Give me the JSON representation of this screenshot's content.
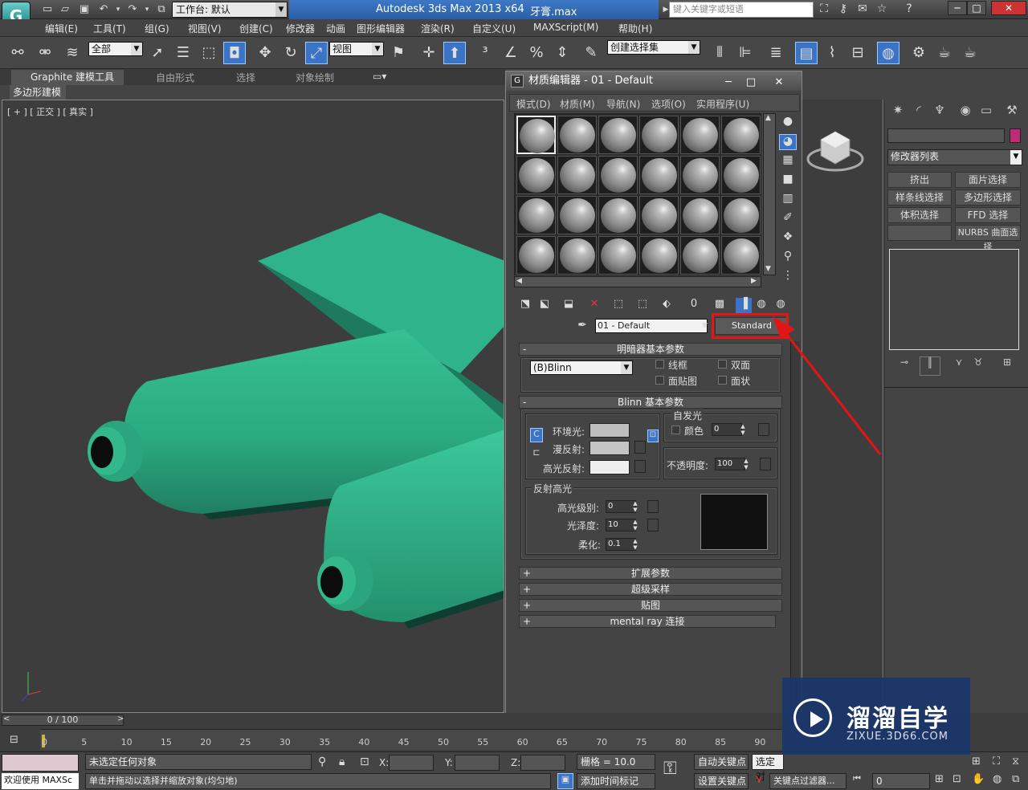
{
  "title": {
    "app_name": "Autodesk 3ds Max  2013 x64",
    "file_name": "牙膏.max",
    "workspace": "工作台: 默认",
    "search_placeholder": "键入关键字或短语"
  },
  "menus": [
    "编辑(E)",
    "工具(T)",
    "组(G)",
    "视图(V)",
    "创建(C)",
    "修改器",
    "动画",
    "图形编辑器",
    "渲染(R)",
    "自定义(U)",
    "MAXScript(M)",
    "帮助(H)"
  ],
  "toolbar": {
    "filter": "全部",
    "refcoord": "视图",
    "selset": "创建选择集"
  },
  "ribbon": {
    "tabs": [
      "Graphite 建模工具",
      "自由形式",
      "选择",
      "对象绘制"
    ],
    "sub": "多边形建模"
  },
  "viewport": {
    "label": "[ + ] [ 正交 ] [ 真实 ]"
  },
  "command_panel": {
    "modifier_list": "修改器列表",
    "buttons": [
      "挤出",
      "面片选择",
      "样条线选择",
      "多边形选择",
      "体积选择",
      "FFD 选择",
      "",
      "NURBS 曲面选择"
    ]
  },
  "material_editor": {
    "title": "材质编辑器 - 01 - Default",
    "menus": [
      "模式(D)",
      "材质(M)",
      "导航(N)",
      "选项(O)",
      "实用程序(U)"
    ],
    "material_name": "01 - Default",
    "material_type": "Standard",
    "rollouts": {
      "shader_basic": "明暗器基本参数",
      "blinn_basic": "Blinn 基本参数",
      "extended": "扩展参数",
      "supersampling": "超级采样",
      "maps": "贴图",
      "mentalray": "mental ray 连接"
    },
    "shader": "(B)Blinn",
    "checkboxes": {
      "wire": "线框",
      "two_sided": "双面",
      "face_map": "面贴图",
      "faceted": "面状"
    },
    "labels": {
      "ambient": "环境光:",
      "diffuse": "漫反射:",
      "specular": "高光反射:",
      "self_illum": "自发光",
      "color": "颜色",
      "opacity": "不透明度:",
      "spec_highlights": "反射高光",
      "spec_level": "高光级别:",
      "glossiness": "光泽度:",
      "soften": "柔化:"
    },
    "values": {
      "self_illum": "0",
      "opacity": "100",
      "spec_level": "0",
      "glossiness": "10",
      "soften": "0.1"
    },
    "colors": {
      "ambient": "#bdbdbd",
      "diffuse": "#c4c4c4",
      "specular": "#eeeeee",
      "highlight_curve": "#111111"
    }
  },
  "timeline": {
    "frame": "0 / 100",
    "ticks": [
      "0",
      "5",
      "10",
      "15",
      "20",
      "25",
      "30",
      "35",
      "40",
      "45",
      "50",
      "55",
      "60",
      "65",
      "70",
      "75",
      "80",
      "85",
      "90"
    ]
  },
  "status": {
    "selection": "未选定任何对象",
    "prompt": "单击并拖动以选择并缩放对象(均匀地)",
    "welcome": "欢迎使用 MAXSc",
    "x": "X:",
    "y": "Y:",
    "z": "Z:",
    "grid": "栅格 = 10.0",
    "add_time_tag": "添加时间标记",
    "auto_key": "自动关键点",
    "sel_obj": "选定对",
    "set_key": "设置关键点",
    "key_filters": "关键点过滤器...",
    "frame_field": "0"
  },
  "watermark": {
    "brand": "溜溜自学",
    "url": "ZIXUE.3D66.COM"
  },
  "colors": {
    "toothpaste": "#2fb38a",
    "highlight_box": "#e41515",
    "accent_blue": "#3b74c6"
  }
}
